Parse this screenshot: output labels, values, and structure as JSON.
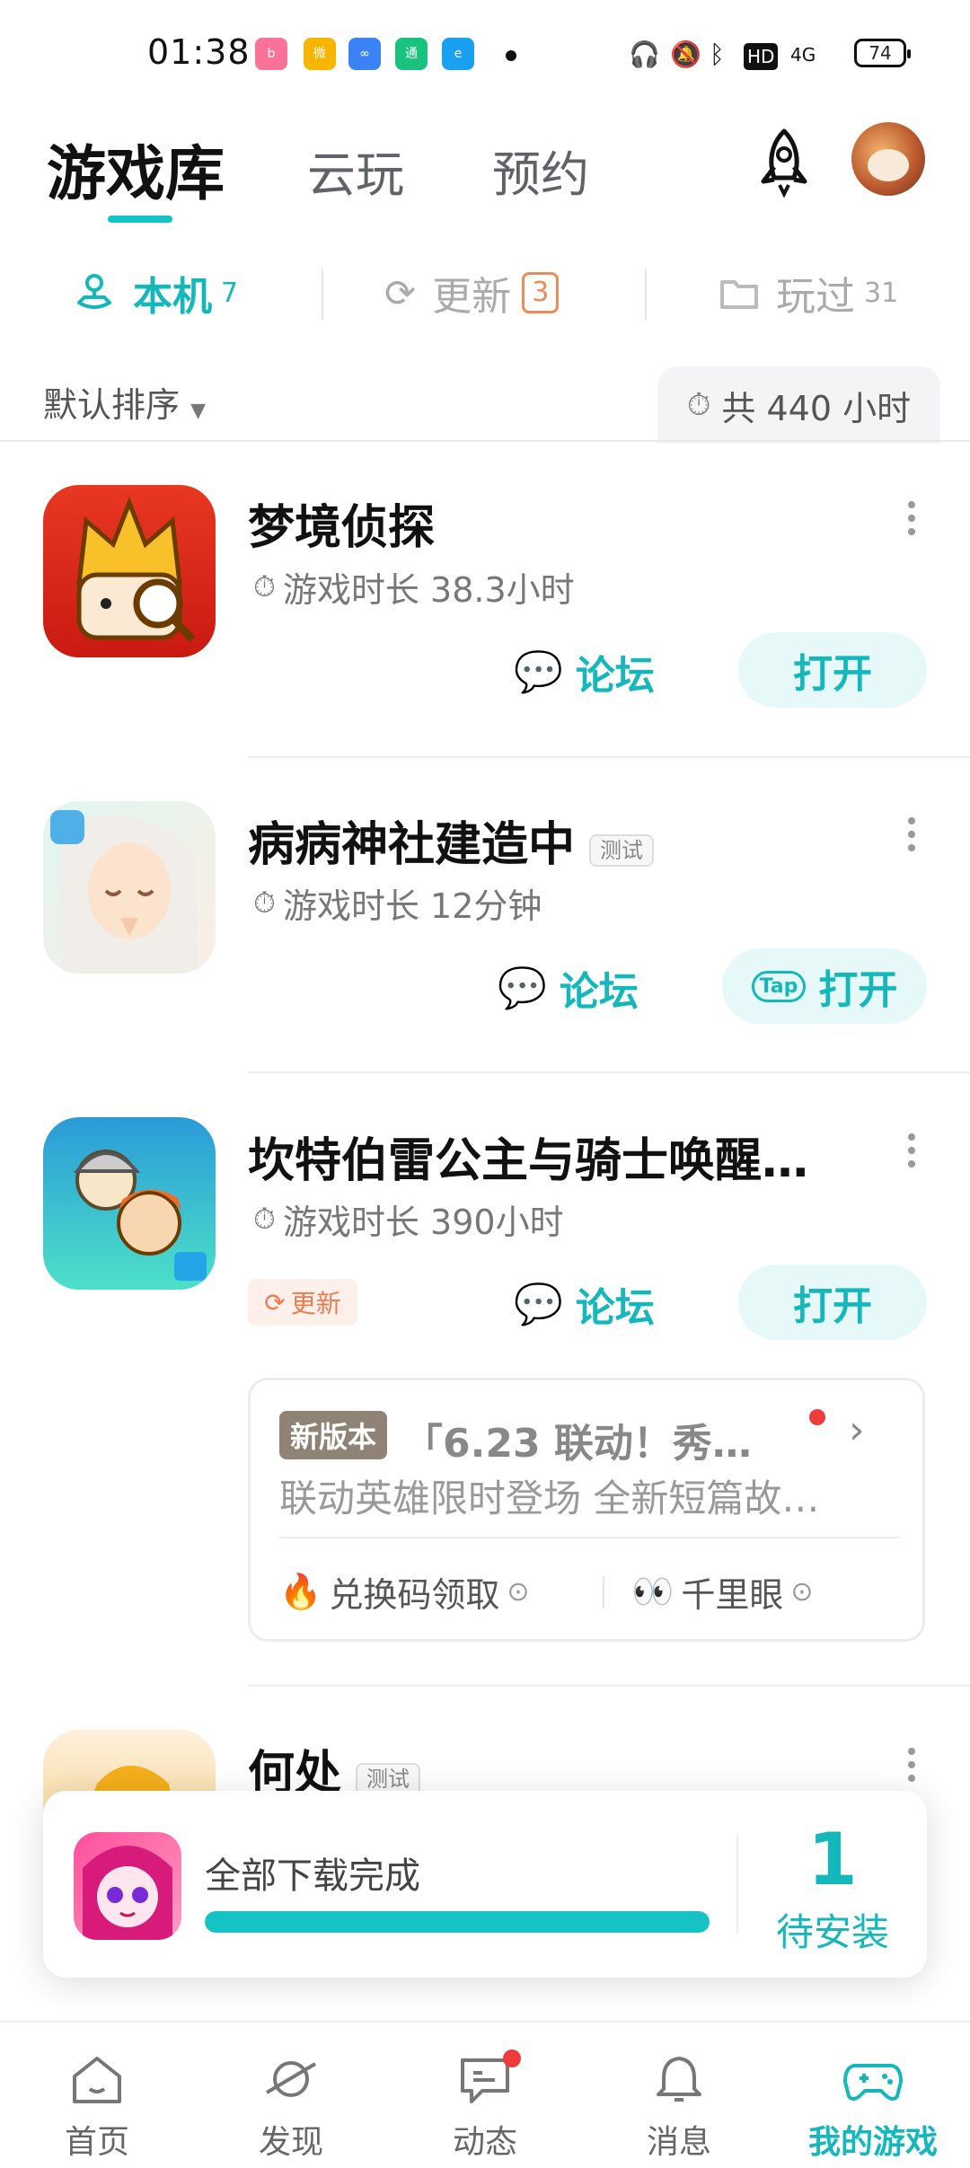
{
  "status_bar": {
    "time": "01:38",
    "apps": [
      {
        "icon": "bilibili-icon",
        "color": "#fb7299"
      },
      {
        "icon": "weibo-icon",
        "color": "#f7b500"
      },
      {
        "icon": "infinity-app-icon",
        "color": "#3b82f6"
      },
      {
        "icon": "green-app-icon",
        "color": "#19c37d"
      },
      {
        "icon": "eleme-icon",
        "color": "#1aa0f0"
      }
    ],
    "hd": "HD",
    "network": "4G",
    "battery": "74"
  },
  "header": {
    "tabs": [
      {
        "label": "游戏库",
        "active": true
      },
      {
        "label": "云玩",
        "active": false
      },
      {
        "label": "预约",
        "active": false
      }
    ]
  },
  "filters": [
    {
      "label": "本机",
      "count": "7",
      "icon": "joystick-icon",
      "active": true
    },
    {
      "label": "更新",
      "count": "3",
      "icon": "refresh-icon",
      "active": false
    },
    {
      "label": "玩过",
      "count": "31",
      "icon": "folder-icon",
      "active": false
    }
  ],
  "sort": {
    "label": "默认排序"
  },
  "total": {
    "label": "共 440 小时"
  },
  "games": [
    {
      "name": "梦境侦探",
      "time": "游戏时长 38.3小时",
      "forum": "论坛",
      "open": "打开"
    },
    {
      "name": "病病神社建造中",
      "tag": "测试",
      "time": "游戏时长 12分钟",
      "forum": "论坛",
      "open": "打开"
    },
    {
      "name": "坎特伯雷公主与骑士唤醒…",
      "time": "游戏时长 390小时",
      "update": "更新",
      "forum": "论坛",
      "open": "打开"
    },
    {
      "name": "何处",
      "tag": "测试"
    }
  ],
  "news_card": {
    "badge": "新版本",
    "title": "「6.23 联动！秀…",
    "subtitle": "联动英雄限时登场 全新短篇故…",
    "links": [
      "兑换码领取",
      "千里眼"
    ]
  },
  "download_toast": {
    "status": "全部下载完成",
    "progress": 1.0,
    "count": "1",
    "count_label": "待安装"
  },
  "bottom_nav": [
    {
      "label": "首页",
      "icon": "home-icon"
    },
    {
      "label": "发现",
      "icon": "planet-icon"
    },
    {
      "label": "动态",
      "icon": "chat-icon",
      "badge": true
    },
    {
      "label": "消息",
      "icon": "bell-icon"
    },
    {
      "label": "我的游戏",
      "icon": "gamepad-icon",
      "active": true
    }
  ],
  "colors": {
    "accent": "#15b8ba",
    "update": "#f07a50",
    "badge": "#ee3b3b"
  }
}
